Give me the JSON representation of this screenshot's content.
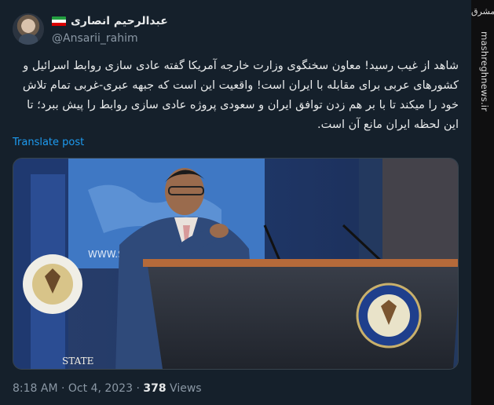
{
  "author": {
    "display_name": "عبدالرحیم انصاری",
    "handle": "@Ansarii_rahim",
    "flag": "iran-flag-icon"
  },
  "tweet": {
    "text": "شاهد از غیب رسید! معاون سخنگوی وزارت خارجه آمریکا گفته عادی سازی روابط اسرائیل و کشورهای عربی برای مقابله با ایران است! واقعیت این است که جبهه عبری-غربی تمام تلاش خود را میکند تا با بر هم زدن توافق ایران و سعودی پروژه عادی سازی روابط را پیش ببرد؛ تا این لحظه ایران مانع آن است.",
    "translate_label": "Translate post",
    "time": "8:18 AM",
    "separator": "·",
    "date": "Oct 4, 2023",
    "views_count": "378",
    "views_label": "Views"
  },
  "media": {
    "podium_sign": "STATE",
    "backdrop_url_text": "WWW.STATE"
  },
  "watermark": {
    "logo": "مشرق",
    "site": "mashreghnews.ir"
  },
  "colors": {
    "background": "#15202b",
    "accent": "#1d9bf0",
    "secondary_text": "#8b98a5"
  }
}
